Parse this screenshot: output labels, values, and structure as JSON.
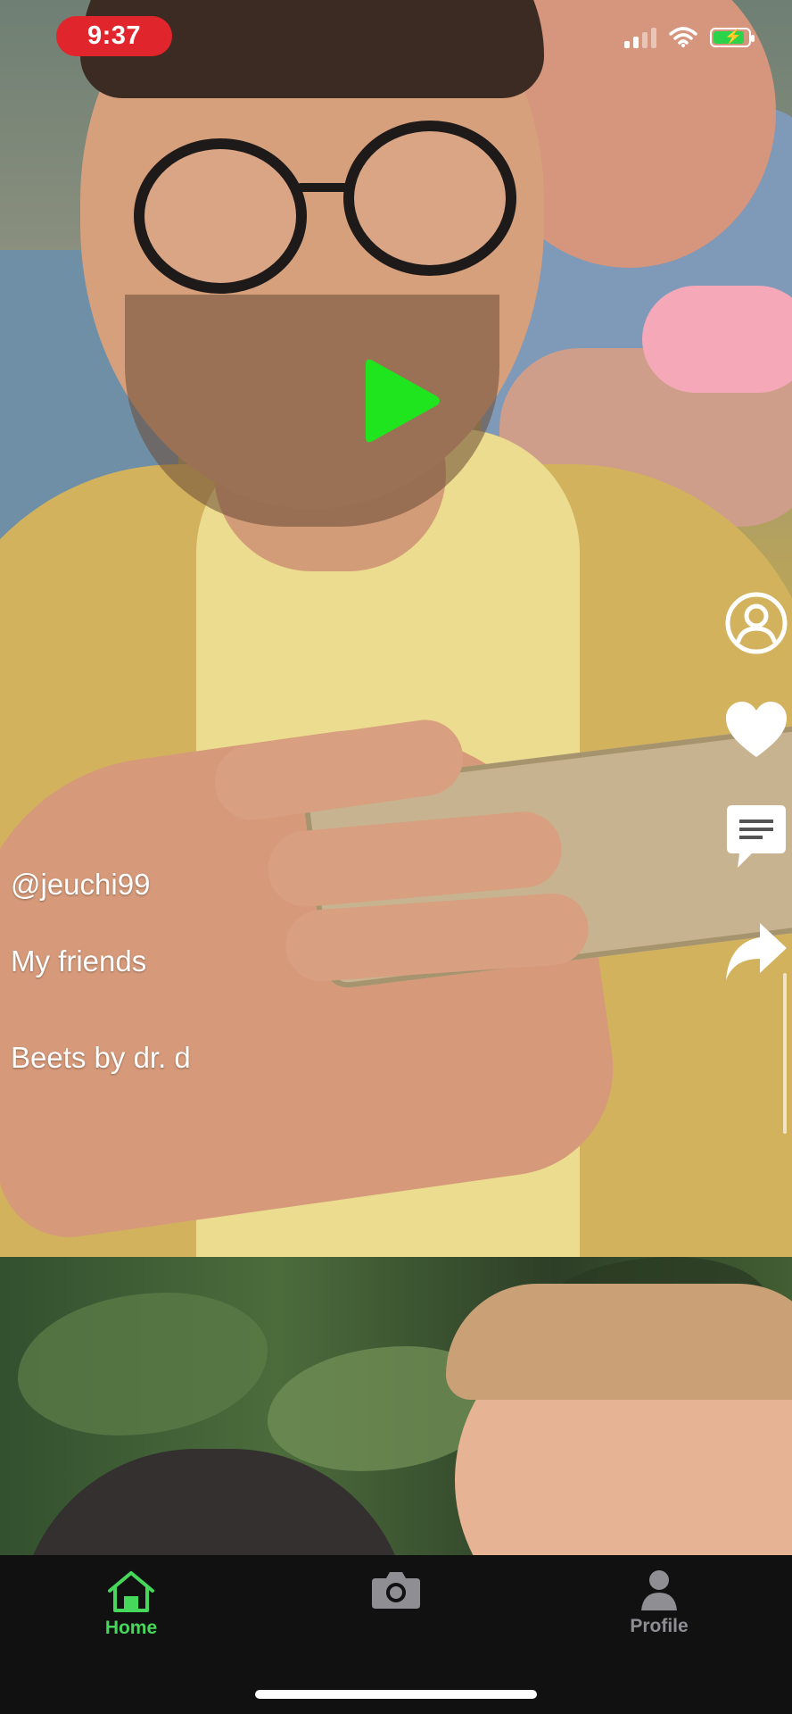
{
  "status_bar": {
    "time": "9:37",
    "icons": [
      "cellular-signal-icon",
      "wifi-icon",
      "battery-charging-icon"
    ],
    "time_pill_color": "#e1252c",
    "battery_color": "#2bd34a"
  },
  "video": {
    "username": "@jeuchi99",
    "caption": "My friends",
    "sound": "Beets by dr. d",
    "play_icon": "play-icon",
    "play_color": "#1ee51e"
  },
  "actions": [
    {
      "name": "profile",
      "icon": "user-circle-icon"
    },
    {
      "name": "like",
      "icon": "heart-icon"
    },
    {
      "name": "comment",
      "icon": "comment-icon"
    },
    {
      "name": "share",
      "icon": "share-icon"
    }
  ],
  "tab_bar": {
    "tabs": [
      {
        "label": "Home",
        "icon": "home-icon",
        "active": true
      },
      {
        "label": "",
        "icon": "camera-icon",
        "active": false
      },
      {
        "label": "Profile",
        "icon": "person-icon",
        "active": false
      }
    ],
    "active_color": "#45d85a",
    "inactive_color": "#8e8e93"
  }
}
